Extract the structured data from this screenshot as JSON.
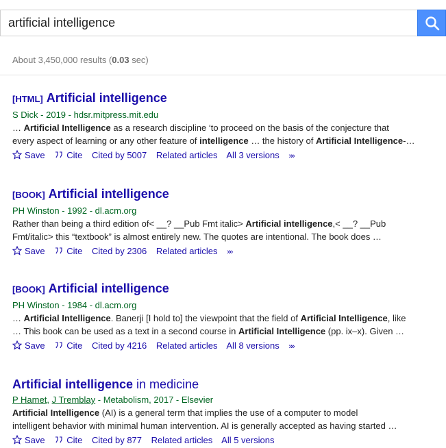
{
  "search": {
    "query": "artificial intelligence"
  },
  "stats": {
    "prefix": "About 3,450,000 results (",
    "time": "0.03",
    "suffix": " sec)"
  },
  "results": [
    {
      "tag": "[HTML]",
      "title": "Artificial intelligence",
      "meta": "S Dick - 2019 - hdsr.mitpress.mit.edu",
      "snippet_lines": [
        [
          {
            "t": "… "
          },
          {
            "b": "Artificial Intelligence"
          },
          {
            "t": " as a research discipline ‘to proceed on the basis of the conjecture that"
          }
        ],
        [
          {
            "t": "every aspect of learning or any other feature of "
          },
          {
            "b": "intelligence"
          },
          {
            "t": " … the history of "
          },
          {
            "b": "Artificial Intelligence"
          },
          {
            "t": "-…"
          }
        ]
      ],
      "links": {
        "save": "Save",
        "cite": "Cite",
        "cited_by": "Cited by 5007",
        "related": "Related articles",
        "versions": "All 3 versions"
      }
    },
    {
      "tag": "[BOOK]",
      "title": "Artificial intelligence",
      "meta": "PH Winston - 1992 - dl.acm.org",
      "snippet_lines": [
        [
          {
            "t": "Rather than being a third edition of< __? __Pub Fmt italic> "
          },
          {
            "b": "Artificial intelligence"
          },
          {
            "t": ",< __? __Pub"
          }
        ],
        [
          {
            "t": "Fmt/italic> this “textbook” is almost entirely new. The quotes are intentional. The book does …"
          }
        ]
      ],
      "links": {
        "save": "Save",
        "cite": "Cite",
        "cited_by": "Cited by 2306",
        "related": "Related articles"
      }
    },
    {
      "tag": "[BOOK]",
      "title": "Artificial intelligence",
      "meta": "PH Winston - 1984 - dl.acm.org",
      "snippet_lines": [
        [
          {
            "t": "… "
          },
          {
            "b": "Artificial Intelligence"
          },
          {
            "t": ". Banerji [I hold to] the viewpoint that the field of "
          },
          {
            "b": "Artificial Intelligence"
          },
          {
            "t": ", like"
          }
        ],
        [
          {
            "t": "… This book can be used as a text in a second course in "
          },
          {
            "b": "Artificial Intelligence"
          },
          {
            "t": " (pp. ix–x). Given …"
          }
        ]
      ],
      "links": {
        "save": "Save",
        "cite": "Cite",
        "cited_by": "Cited by 4216",
        "related": "Related articles",
        "versions": "All 8 versions"
      }
    },
    {
      "title_bold": "Artificial intelligence",
      "title_rest": " in medicine",
      "authors": [
        "P Hamet",
        "J Tremblay"
      ],
      "meta_rest": " - Metabolism, 2017 - Elsevier",
      "snippet_lines": [
        [
          {
            "b": "Artificial Intelligence"
          },
          {
            "t": " (AI) is a general term that implies the use of a computer to model"
          }
        ],
        [
          {
            "t": "intelligent behavior with minimal human intervention. AI is generally accepted as having started …"
          }
        ]
      ],
      "links": {
        "save": "Save",
        "cite": "Cite",
        "cited_by": "Cited by 877",
        "related": "Related articles",
        "versions": "All 5 versions"
      }
    }
  ],
  "colors": {
    "accent": "#4d90fe",
    "link": "#1a0dab",
    "meta": "#006621",
    "muted": "#777777"
  },
  "icons": {
    "search": "search-icon",
    "save": "star-icon",
    "cite": "quote-icon",
    "more": "double-chevron-icon"
  }
}
